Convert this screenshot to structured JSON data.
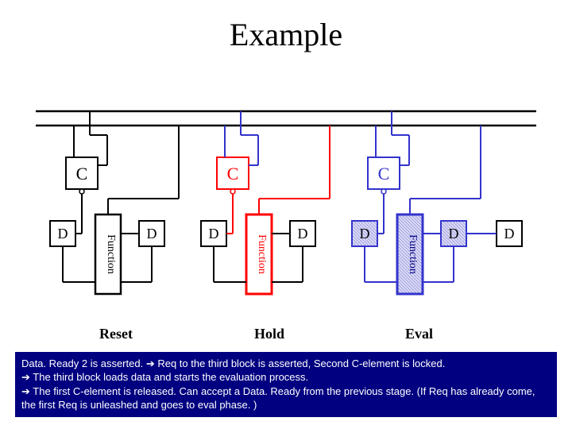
{
  "title": "Example",
  "diagram": {
    "blocks": {
      "c_label": "C",
      "d_label": "D",
      "function_label": "Function"
    },
    "states": [
      "Reset",
      "Hold",
      "Eval"
    ],
    "colors": {
      "normal": "#000000",
      "active": "#ff0000",
      "eval": "#3333cc",
      "eval_fill": "#d8d8f6"
    }
  },
  "footer": {
    "line1_a": "Data. Ready 2 is asserted. ",
    "line1_b": " Req to the third block is asserted, Second C-element is locked.",
    "line2": " The third block loads data and starts the evaluation process.",
    "line3": " The first C-element is released. Can accept a Data. Ready from the previous stage. (If Req has already come, the first Req is unleashed and goes to eval phase. )",
    "arrow": "➔"
  }
}
